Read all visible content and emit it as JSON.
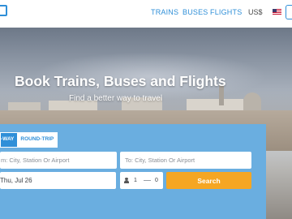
{
  "nav": {
    "items": [
      "TRAINS",
      "BUSES",
      "FLIGHTS"
    ],
    "currency": "US$",
    "flag_icon": "us-flag-icon",
    "menu_icon": "menu-icon"
  },
  "hero": {
    "title": "Book Trains, Buses and Flights",
    "subtitle": "Find a better way to travel"
  },
  "search": {
    "trip_types": [
      "-WAY",
      "ROUND-TRIP"
    ],
    "selected_trip_type": "-WAY",
    "from_placeholder": "m: City, Station Or Airport",
    "to_placeholder": "To: City, Station Or Airport",
    "date_value": "Thu, Jul 26",
    "passengers": {
      "adults": "1",
      "children": "0",
      "icon": "person-icon"
    },
    "search_label": "Search"
  },
  "colors": {
    "accent": "#2f8fd8",
    "panel": "#6aaee0",
    "search_button": "#f5a623"
  }
}
